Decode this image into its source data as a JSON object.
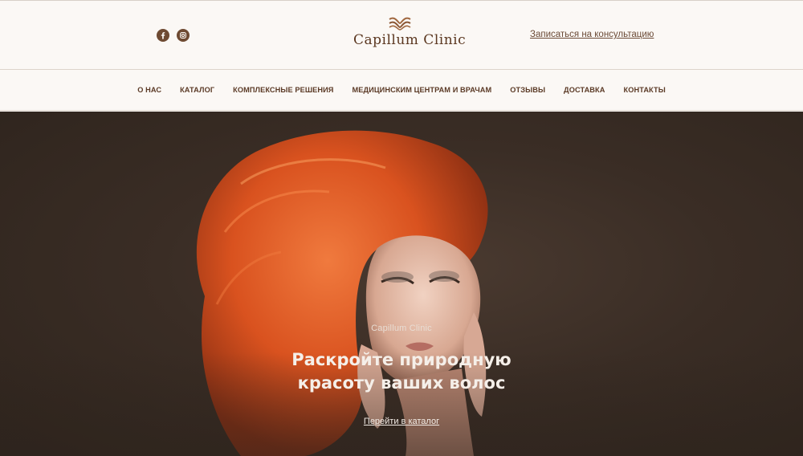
{
  "header": {
    "social": [
      {
        "name": "facebook-icon",
        "glyph": "f"
      },
      {
        "name": "instagram-icon",
        "glyph": "o"
      }
    ],
    "logo_text": "Capillum Clinic",
    "consult_link": "Записаться на консультацию"
  },
  "nav": {
    "items": [
      "О НАС",
      "КАТАЛОГ",
      "КОМПЛЕКСНЫЕ РЕШЕНИЯ",
      "МЕДИЦИНСКИМ ЦЕНТРАМ И ВРАЧАМ",
      "ОТЗЫВЫ",
      "ДОСТАВКА",
      "КОНТАКТЫ"
    ]
  },
  "hero": {
    "brand": "Capillum Clinic",
    "title": "Раскройте природную красоту ваших волос",
    "cta": "Перейти в каталог"
  },
  "colors": {
    "brand_brown": "#6e4a32",
    "header_bg": "#fbf8f5",
    "hero_bg": "#3a2d25",
    "hair": "#e2572a"
  }
}
